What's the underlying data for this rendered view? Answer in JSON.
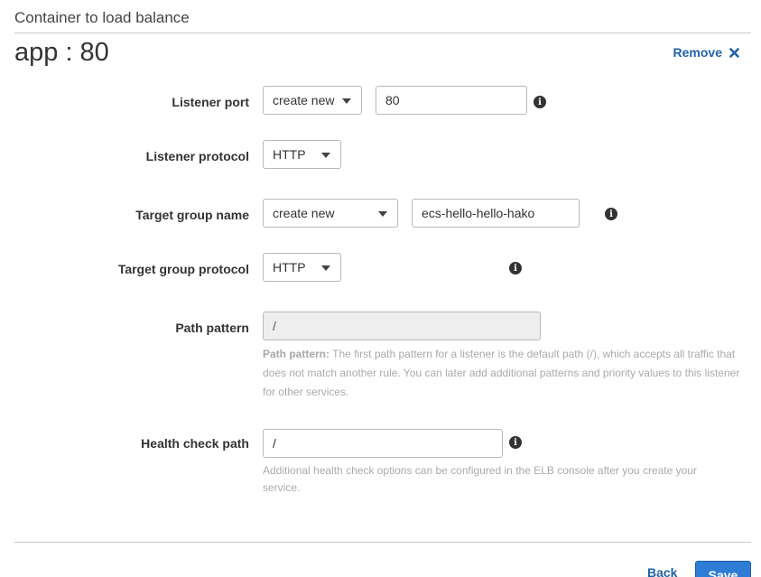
{
  "section": {
    "title": "Container to load balance"
  },
  "container": {
    "name": "app : 80"
  },
  "remove": {
    "label": "Remove"
  },
  "form": {
    "listener_port": {
      "label": "Listener port",
      "mode": "create new",
      "value": "80"
    },
    "listener_protocol": {
      "label": "Listener protocol",
      "value": "HTTP"
    },
    "target_group_name": {
      "label": "Target group name",
      "mode": "create new",
      "value": "ecs-hello-hello-hako"
    },
    "target_group_protocol": {
      "label": "Target group protocol",
      "value": "HTTP"
    },
    "path_pattern": {
      "label": "Path pattern",
      "value": "/",
      "help_title": "Path pattern:",
      "help_text": "The first path pattern for a listener is the default path (/), which accepts all traffic that does not match another rule. You can later add additional patterns and priority values to this listener for other services."
    },
    "health_check_path": {
      "label": "Health check path",
      "value": "/",
      "help_text": "Additional health check options can be configured in the ELB console after you create your service."
    }
  },
  "footer": {
    "back_label": "Back",
    "save_label": "Save"
  },
  "icons": {
    "info": "info-icon",
    "remove": "close-icon",
    "dropdown": "chevron-down-icon"
  },
  "colors": {
    "link": "#1f63a6",
    "primary_button": "#2e7cd6",
    "help_text": "#aaaaaa"
  }
}
